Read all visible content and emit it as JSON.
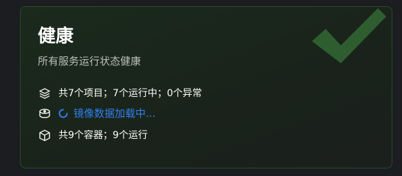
{
  "card": {
    "title": "健康",
    "subtitle": "所有服务运行状态健康",
    "status_icon": "check-mark-icon",
    "accent_color": "#2e5e30"
  },
  "stats": {
    "projects": {
      "icon": "layers-icon",
      "text": "共7个项目；7个运行中；0个异常"
    },
    "images": {
      "icon": "database-icon",
      "loading_icon": "spinner-icon",
      "text": "镜像数据加载中...",
      "color": "#2f80ed"
    },
    "containers": {
      "icon": "box-icon",
      "text": "共9个容器；9个运行"
    }
  }
}
